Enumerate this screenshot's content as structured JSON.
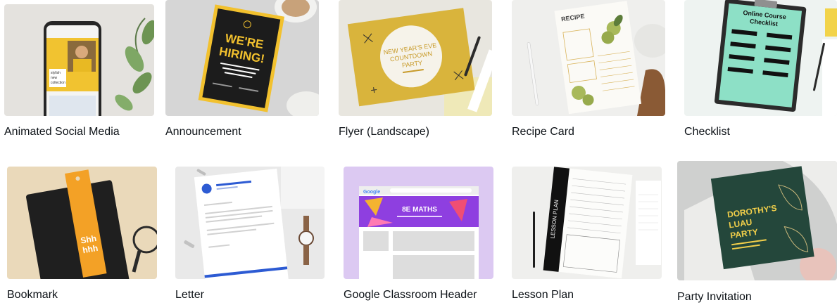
{
  "templates": [
    {
      "label": "Animated Social Media",
      "phone_text_1": "stylish",
      "phone_text_2": "new",
      "phone_text_3": "collection"
    },
    {
      "label": "Announcement",
      "poster_line_1": "WE'RE",
      "poster_line_2": "HIRING!"
    },
    {
      "label": "Flyer (Landscape)",
      "flyer_line_1": "NEW YEAR'S EVE",
      "flyer_line_2": "COUNTDOWN",
      "flyer_line_3": "PARTY"
    },
    {
      "label": "Recipe Card",
      "card_title": "RECIPE"
    },
    {
      "label": "Checklist",
      "board_line_1": "Online Course",
      "board_line_2": "Checklist"
    },
    {
      "label": "Bookmark",
      "bookmark_line_1": "Shh",
      "bookmark_line_2": "hhh"
    },
    {
      "label": "Letter"
    },
    {
      "label": "Google Classroom Header",
      "browser_brand": "Google",
      "banner_title": "8E MATHS"
    },
    {
      "label": "Lesson Plan",
      "strip_text": "LESSON PLAN"
    },
    {
      "label": "Party Invitation",
      "invite_line_1": "DOROTHY'S",
      "invite_line_2": "LUAU",
      "invite_line_3": "PARTY"
    }
  ]
}
